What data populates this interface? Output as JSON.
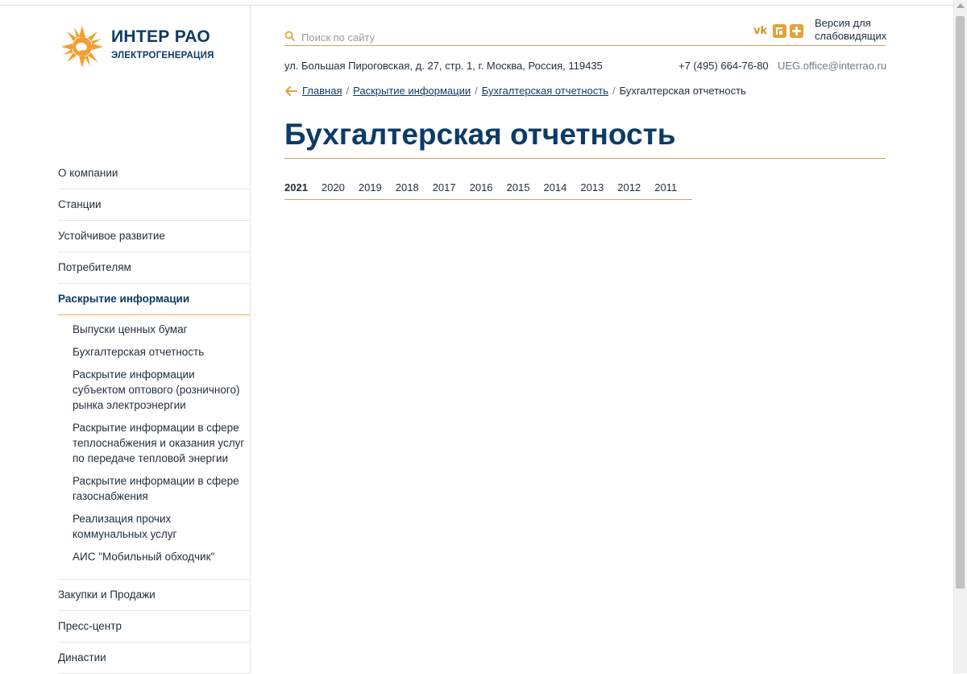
{
  "logo": {
    "name": "ИНТЕР РАО",
    "subtitle": "ЭЛЕКТРОГЕНЕРАЦИЯ",
    "colors": {
      "sun": "#f0a030",
      "text": "#0e3b66"
    }
  },
  "search": {
    "placeholder": "Поиск по сайту",
    "value": ""
  },
  "header": {
    "social_icons": [
      "vk-icon",
      "rss-icon",
      "plus-icon"
    ],
    "vk_label": "vk",
    "accessible_version": "Версия для слабовидящих"
  },
  "contacts": {
    "address": "ул. Большая Пироговская, д. 27, стр. 1, г. Москва, Россия, 119435",
    "phone": "+7 (495) 664-76-80",
    "email": "UEG.office@interrao.ru"
  },
  "breadcrumb": {
    "items": [
      "Главная",
      "Раскрытие информации",
      "Бухгалтерская отчетность"
    ],
    "current": "Бухгалтерская отчетность",
    "separator": "/"
  },
  "page": {
    "title": "Бухгалтерская отчетность"
  },
  "years": {
    "items": [
      "2021",
      "2020",
      "2019",
      "2018",
      "2017",
      "2016",
      "2015",
      "2014",
      "2013",
      "2012",
      "2011"
    ],
    "active": "2021"
  },
  "sidebar": {
    "items": [
      {
        "label": "О компании"
      },
      {
        "label": "Станции"
      },
      {
        "label": "Устойчивое развитие"
      },
      {
        "label": "Потребителям"
      },
      {
        "label": "Раскрытие информации",
        "active": true
      },
      {
        "label": "Закупки и Продажи"
      },
      {
        "label": "Пресс-центр"
      },
      {
        "label": "Династии"
      }
    ],
    "subitems": [
      {
        "label": "Выпуски ценных бумаг"
      },
      {
        "label": "Бухгалтерская отчетность"
      },
      {
        "label": "Раскрытие информации субъектом оптового (розничного) рынка электроэнергии"
      },
      {
        "label": "Раскрытие информации в сфере теплоснабжения и оказания услуг по передаче тепловой энергии"
      },
      {
        "label": "Раскрытие информации в сфере газоснабжения"
      },
      {
        "label": "Реализация прочих коммунальных услуг"
      },
      {
        "label": "АИС \"Мобильный обходчик\""
      }
    ]
  },
  "colors": {
    "accent": "#e3a23c",
    "brand": "#0e3b66",
    "divider": "#c8a85c"
  }
}
